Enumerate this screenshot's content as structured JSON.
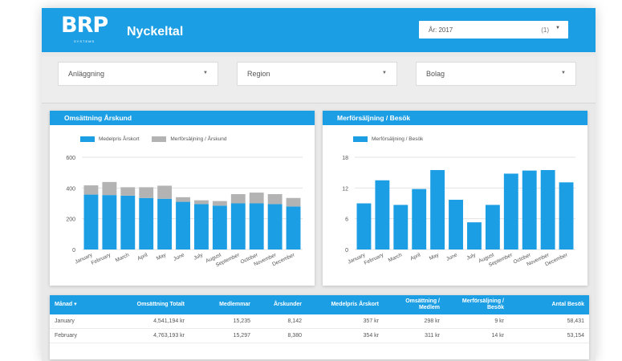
{
  "header": {
    "logo": "BRP",
    "logo_sub": "SYSTEMS",
    "title": "Nyckeltal",
    "year_label": "År: 2017",
    "year_count": "(1)"
  },
  "filters": [
    {
      "label": "Anläggning"
    },
    {
      "label": "Region"
    },
    {
      "label": "Bolag"
    }
  ],
  "charts": {
    "left_title": "Omsättning Årskund",
    "right_title": "Merförsäljning / Besök"
  },
  "chart_data": [
    {
      "type": "bar",
      "stacked": true,
      "title": "Omsättning Årskund",
      "categories": [
        "January",
        "February",
        "March",
        "April",
        "May",
        "June",
        "July",
        "August",
        "September",
        "October",
        "November",
        "December"
      ],
      "series": [
        {
          "name": "Medelpris Årskort",
          "color": "#1b9ee3",
          "values": [
            357,
            354,
            350,
            335,
            330,
            310,
            295,
            285,
            300,
            300,
            295,
            280
          ]
        },
        {
          "name": "Merförsäljning / Årskund",
          "color": "#b3b3b3",
          "values": [
            60,
            85,
            55,
            70,
            85,
            30,
            25,
            30,
            60,
            70,
            65,
            55
          ]
        }
      ],
      "ylim": [
        0,
        600
      ],
      "yticks": [
        0,
        200,
        400,
        600
      ],
      "grid": true,
      "legend": "top-left"
    },
    {
      "type": "bar",
      "title": "Merförsäljning / Besök",
      "categories": [
        "January",
        "February",
        "March",
        "April",
        "May",
        "June",
        "July",
        "August",
        "September",
        "October",
        "November",
        "December"
      ],
      "series": [
        {
          "name": "Merförsäljning / Besök",
          "color": "#1b9ee3",
          "values": [
            9,
            13.5,
            8.7,
            11.8,
            15.5,
            9.7,
            5.3,
            8.7,
            14.8,
            15.4,
            15.5,
            13.1
          ]
        }
      ],
      "ylim": [
        0,
        18
      ],
      "yticks": [
        0,
        6,
        12,
        18
      ],
      "grid": true,
      "legend": "top-left"
    }
  ],
  "table": {
    "columns": [
      "Månad",
      "Omsättning Totalt",
      "Medlemmar",
      "Årskunder",
      "Medelpris Årskort",
      "Omsättning / Medlem",
      "Merförsäljning / Besök",
      "Antal Besök"
    ],
    "sort_indicator": "▾",
    "rows": [
      [
        "January",
        "4,541,194 kr",
        "15,235",
        "8,142",
        "357 kr",
        "298 kr",
        "9 kr",
        "58,431"
      ],
      [
        "February",
        "4,763,193 kr",
        "15,297",
        "8,380",
        "354 kr",
        "311 kr",
        "14 kr",
        "53,154"
      ]
    ]
  },
  "colors": {
    "accent": "#1b9ee3",
    "secondary": "#b3b3b3",
    "background": "#e9e9e9"
  }
}
